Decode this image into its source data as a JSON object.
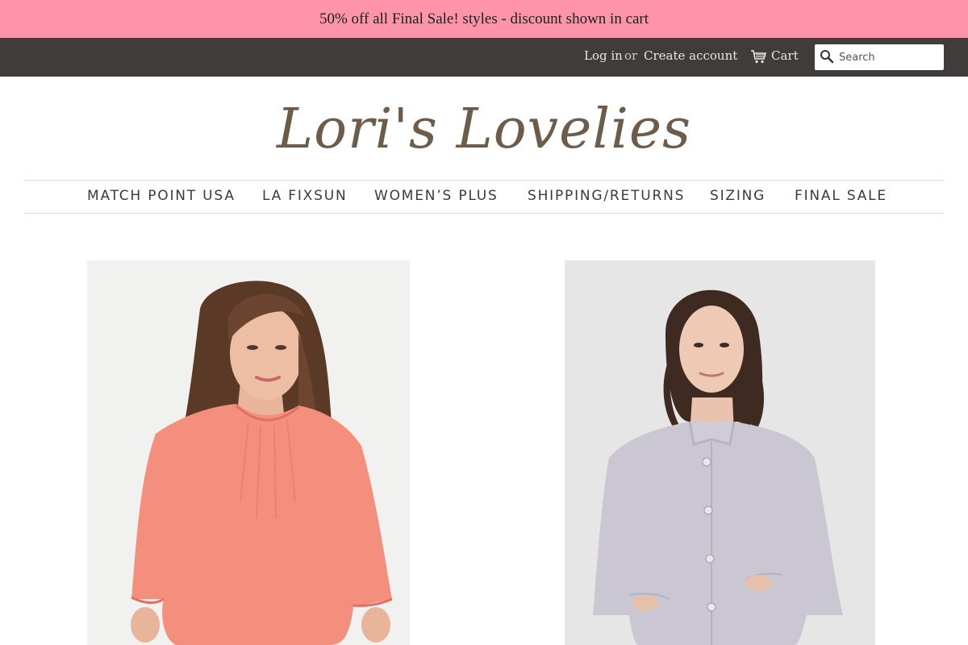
{
  "announcement": {
    "text": "50% off all Final Sale! styles - discount shown in cart"
  },
  "topbar": {
    "login_label": "Log in",
    "or_label": "or",
    "create_account_label": "Create account",
    "cart_label": "Cart",
    "cart_icon": "cart-icon",
    "search": {
      "placeholder": "Search",
      "value": "",
      "icon": "search-icon"
    }
  },
  "logo": {
    "text": "Lori's Lovelies"
  },
  "nav": {
    "items": [
      {
        "label": "MATCH POINT USA"
      },
      {
        "label": "LA FIXSUN"
      },
      {
        "label": "WOMEN’S PLUS"
      },
      {
        "label": "SHIPPING/RETURNS"
      },
      {
        "label": "SIZING"
      },
      {
        "label": "FINAL SALE"
      }
    ]
  },
  "colors": {
    "announcement_bg": "#fe93a9",
    "topbar_bg": "#403c3a",
    "logo": "#6e5c4b",
    "nav_text": "#3f3a37"
  },
  "products": [
    {
      "image": "coral-peasant-top-photo"
    },
    {
      "image": "grey-linen-button-jacket-photo"
    }
  ]
}
